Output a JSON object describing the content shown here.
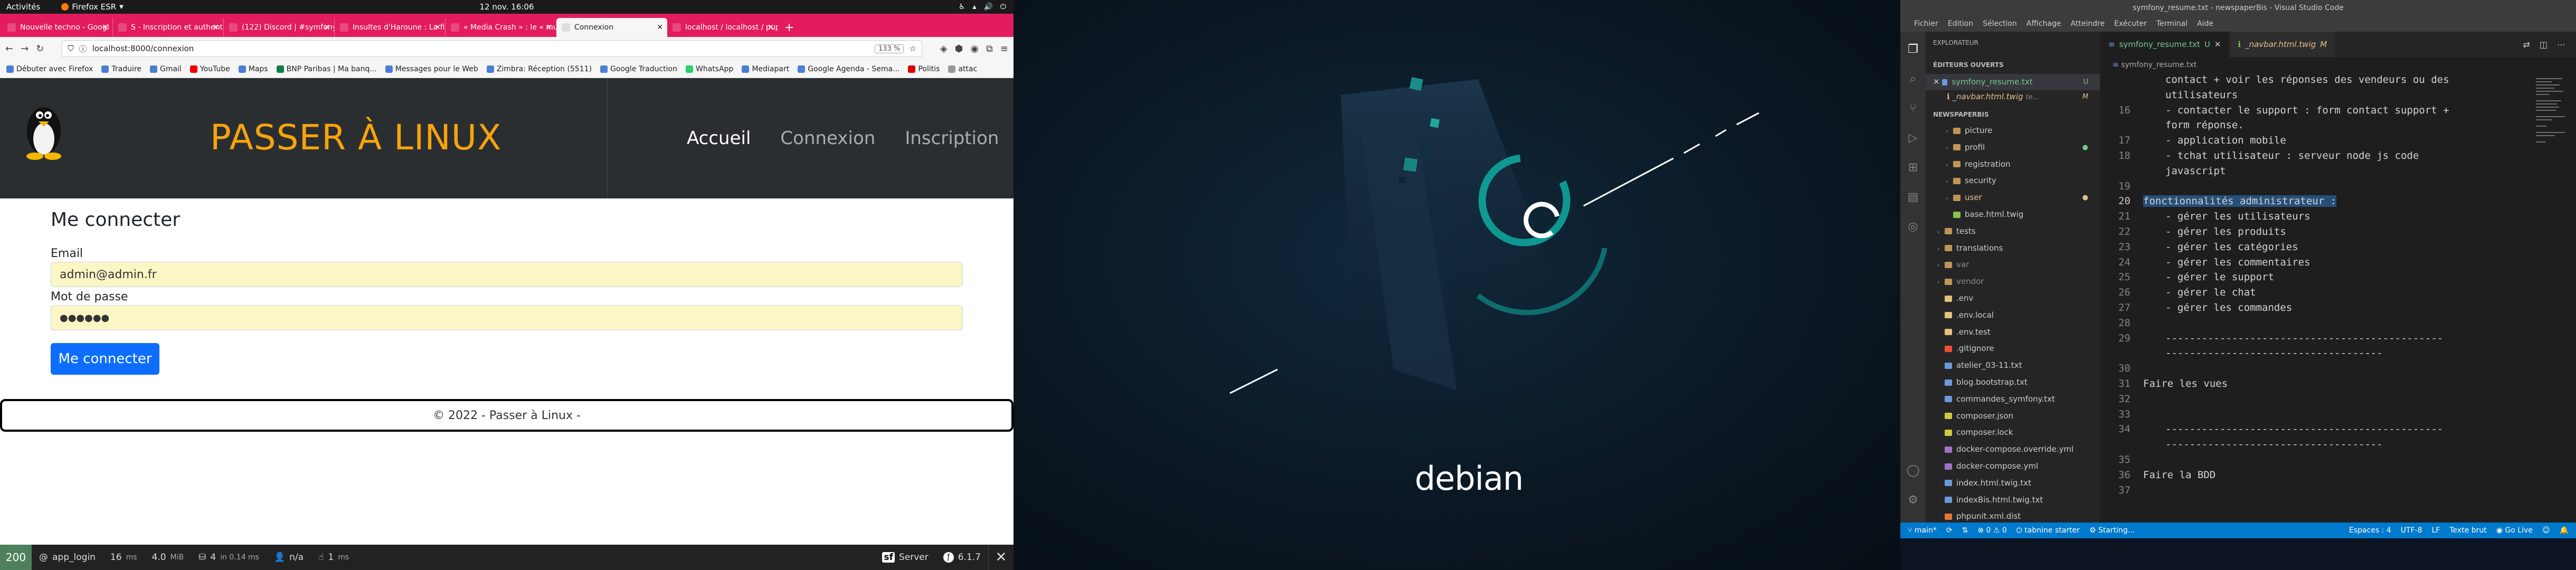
{
  "gnome": {
    "activities": "Activités",
    "app": "Firefox ESR",
    "clock": "12 nov. 16:06"
  },
  "firefox": {
    "tabs": [
      {
        "label": "Nouvelle techno - Googl"
      },
      {
        "label": "S - Inscription et authenti"
      },
      {
        "label": "(122) Discord | #symfony"
      },
      {
        "label": "Insultes d'Haroune : La fi"
      },
      {
        "label": "« Media Crash » : le « mu"
      },
      {
        "label": "Connexion",
        "active": true
      },
      {
        "label": "localhost / localhost / pup"
      }
    ],
    "url": "localhost:8000/connexion",
    "zoom": "133 %",
    "bookmarks": [
      "Débuter avec Firefox",
      "Traduire",
      "Gmail",
      "YouTube",
      "Maps",
      "BNP Paribas | Ma banq...",
      "Messages pour le Web",
      "Zimbra: Réception (5511)",
      "Google Traduction",
      "WhatsApp",
      "Mediapart",
      "Google Agenda - Sema...",
      "Politis",
      "attac"
    ]
  },
  "site": {
    "brand": "PASSER À LINUX",
    "nav": [
      "Accueil",
      "Connexion",
      "Inscription"
    ],
    "form": {
      "title": "Me connecter",
      "email_label": "Email",
      "email_value": "admin@admin.fr",
      "password_label": "Mot de passe",
      "password_value": "●●●●●●",
      "submit": "Me connecter"
    },
    "footer": "© 2022 - Passer à Linux -"
  },
  "symfony_toolbar": {
    "status": "200",
    "route": "app_login",
    "time": "16",
    "time_unit": "ms",
    "memory": "4.0",
    "memory_unit": "MiB",
    "db": "4",
    "db_text": "in 0.14 ms",
    "user": "n/a",
    "events": "1",
    "events_unit": "ms",
    "server": "Server",
    "version": "6.1.7"
  },
  "wallpaper": {
    "logo_text": "debian"
  },
  "vscode": {
    "title": "symfony_resume.txt - newspaperBis - Visual Studio Code",
    "menu": [
      "Fichier",
      "Edition",
      "Sélection",
      "Affichage",
      "Atteindre",
      "Exécuter",
      "Terminal",
      "Aide"
    ],
    "explorer_header": "EXPLORATEUR",
    "open_editors_header": "ÉDITEURS OUVERTS",
    "open_editors": [
      {
        "name": "symfony_resume.txt",
        "badge": "U"
      },
      {
        "name": "_navbar.html.twig",
        "extra": "te...",
        "badge": "M"
      }
    ],
    "project_header": "NEWSPAPERBIS",
    "files": [
      {
        "name": "picture",
        "type": "folder"
      },
      {
        "name": "profil",
        "type": "folder"
      },
      {
        "name": "registration",
        "type": "folder"
      },
      {
        "name": "security",
        "type": "folder"
      },
      {
        "name": "user",
        "type": "folder"
      },
      {
        "name": "base.html.twig",
        "type": "twig"
      },
      {
        "name": "tests",
        "type": "folder"
      },
      {
        "name": "translations",
        "type": "folder"
      },
      {
        "name": "var",
        "type": "folder"
      },
      {
        "name": "vendor",
        "type": "folder"
      },
      {
        "name": ".env",
        "type": "env"
      },
      {
        "name": ".env.local",
        "type": "env"
      },
      {
        "name": ".env.test",
        "type": "env"
      },
      {
        "name": ".gitignore",
        "type": "git"
      },
      {
        "name": "atelier_03-11.txt",
        "type": "txt"
      },
      {
        "name": "blog.bootstrap.txt",
        "type": "txt"
      },
      {
        "name": "commandes_symfony.txt",
        "type": "txt"
      },
      {
        "name": "composer.json",
        "type": "json"
      },
      {
        "name": "composer.lock",
        "type": "json"
      },
      {
        "name": "docker-compose.override.yml",
        "type": "yml"
      },
      {
        "name": "docker-compose.yml",
        "type": "yml"
      },
      {
        "name": "index.html.twig.txt",
        "type": "txt"
      },
      {
        "name": "indexBis.html.twig.txt",
        "type": "txt"
      },
      {
        "name": "phpunit.xml.dist",
        "type": "xml"
      }
    ],
    "editor_tabs": [
      {
        "name": "symfony_resume.txt",
        "badge": "U",
        "active": true
      },
      {
        "name": "_navbar.html.twig",
        "badge": "M"
      }
    ],
    "breadcrumb": "symfony_resume.txt",
    "lines": [
      {
        "n": "",
        "t": "contact + voir les réponses des vendeurs ou des"
      },
      {
        "n": "",
        "t": "utilisateurs"
      },
      {
        "n": "16",
        "t": "- contacter le support : form contact support +"
      },
      {
        "n": "",
        "t": "form réponse."
      },
      {
        "n": "17",
        "t": "- application mobile"
      },
      {
        "n": "18",
        "t": "- tchat utilisateur : serveur node js code"
      },
      {
        "n": "",
        "t": "javascript"
      },
      {
        "n": "19",
        "t": ""
      },
      {
        "n": "20",
        "t": "fonctionnalités administrateur :"
      },
      {
        "n": "21",
        "t": "- gérer les utilisateurs"
      },
      {
        "n": "22",
        "t": "- gérer les produits"
      },
      {
        "n": "23",
        "t": "- gérer les catégories"
      },
      {
        "n": "24",
        "t": "- gérer les commentaires"
      },
      {
        "n": "25",
        "t": "- gérer le support"
      },
      {
        "n": "26",
        "t": "- gérer le chat"
      },
      {
        "n": "27",
        "t": "- gérer les commandes"
      },
      {
        "n": "28",
        "t": ""
      },
      {
        "n": "29",
        "t": "----------------------------------------------"
      },
      {
        "n": "",
        "t": "------------------------------------"
      },
      {
        "n": "30",
        "t": ""
      },
      {
        "n": "31",
        "t": "Faire les vues"
      },
      {
        "n": "32",
        "t": ""
      },
      {
        "n": "33",
        "t": ""
      },
      {
        "n": "34",
        "t": "----------------------------------------------"
      },
      {
        "n": "",
        "t": "------------------------------------"
      },
      {
        "n": "35",
        "t": ""
      },
      {
        "n": "36",
        "t": "Faire la BDD"
      },
      {
        "n": "37",
        "t": ""
      }
    ],
    "status_left": [
      "main*",
      "⊗ 0 ⚠ 0",
      "tabnine starter",
      "Starting..."
    ],
    "status_right": [
      "Espaces : 4",
      "UTF-8",
      "LF",
      "Texte brut",
      "Go Live"
    ]
  }
}
